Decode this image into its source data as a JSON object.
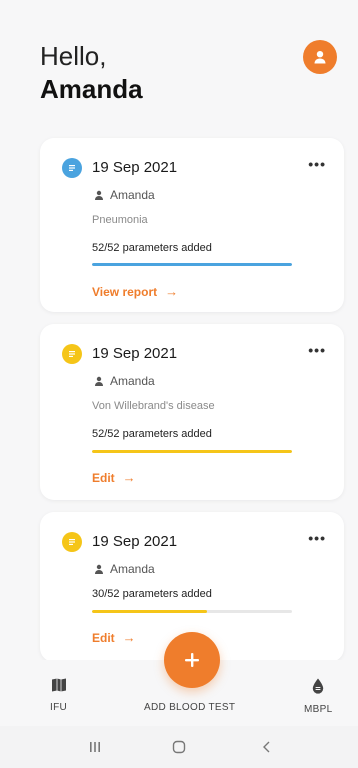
{
  "greeting": {
    "hello": "Hello,",
    "name": "Amanda"
  },
  "reports": [
    {
      "date": "19 Sep 2021",
      "user": "Amanda",
      "condition": "Pneumonia",
      "params_text": "52/52 parameters added",
      "progress": 1.0,
      "accent": "#4aa3df",
      "action": "View report",
      "arrow": "→",
      "menu": "•••"
    },
    {
      "date": "19 Sep 2021",
      "user": "Amanda",
      "condition": "Von Willebrand's disease",
      "params_text": "52/52 parameters added",
      "progress": 1.0,
      "accent": "#f5c518",
      "action": "Edit",
      "arrow": "→",
      "menu": "•••"
    },
    {
      "date": "19 Sep 2021",
      "user": "Amanda",
      "params_text": "30/52 parameters added",
      "progress": 0.577,
      "accent": "#f5c518",
      "action": "Edit",
      "arrow": "→",
      "menu": "•••"
    }
  ],
  "bottom_nav": {
    "ifu": "IFU",
    "add": "ADD BLOOD TEST",
    "mbpl": "MBPL"
  },
  "fab_label": "+",
  "colors": {
    "brand": "#ef7d2c",
    "blue": "#4aa3df",
    "yellow": "#f5c518"
  },
  "icons": [
    "user-avatar-icon",
    "document-icon",
    "person-icon",
    "more-icon",
    "book-icon",
    "drop-icon",
    "plus-icon",
    "recents-icon",
    "home-icon",
    "back-icon"
  ]
}
